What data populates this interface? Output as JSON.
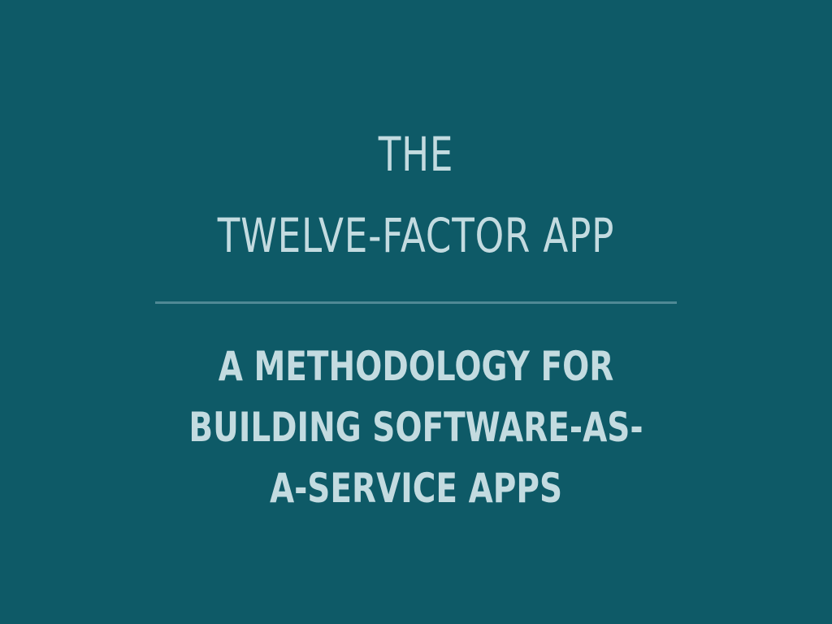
{
  "slide": {
    "title_lines": [
      "THE",
      "TWELVE-FACTOR APP"
    ],
    "subtitle_lines": [
      "A METHODOLOGY FOR",
      "BUILDING SOFTWARE-AS-",
      "A-SERVICE APPS"
    ]
  },
  "colors": {
    "background": "#0e5a67",
    "text": "#c3dbe0",
    "divider": "#4f8995"
  }
}
